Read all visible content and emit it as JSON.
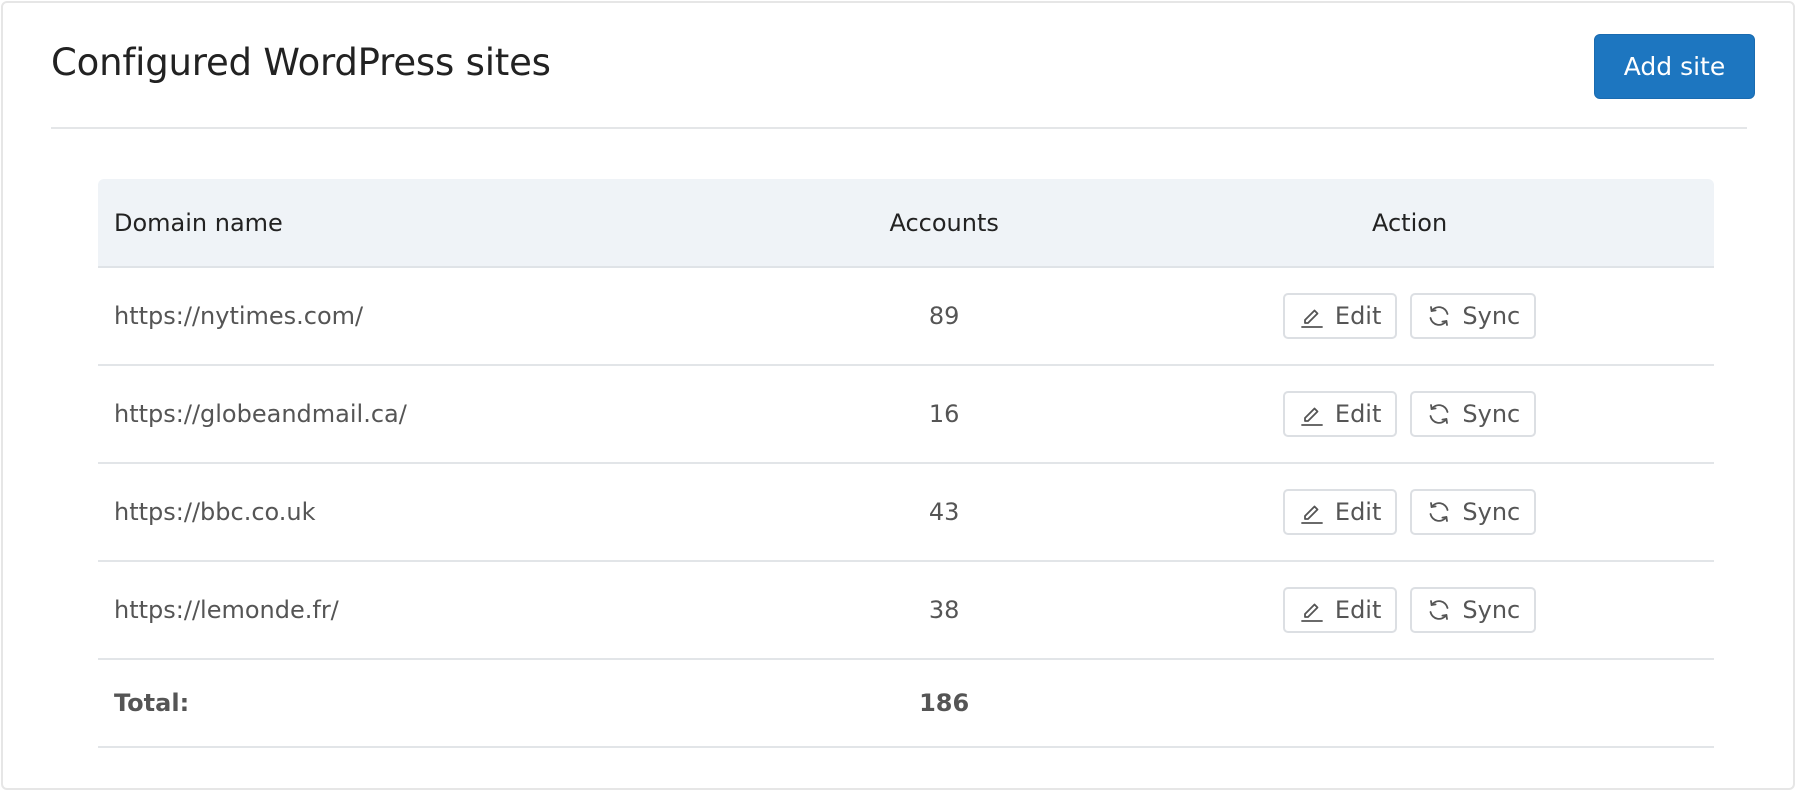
{
  "header": {
    "title": "Configured WordPress sites",
    "add_button_label": "Add site"
  },
  "table": {
    "columns": [
      "Domain name",
      "Accounts",
      "Action"
    ],
    "rows": [
      {
        "domain": "https://nytimes.com/",
        "accounts": "89",
        "edit_label": "Edit",
        "sync_label": "Sync"
      },
      {
        "domain": "https://globeandmail.ca/",
        "accounts": "16",
        "edit_label": "Edit",
        "sync_label": "Sync"
      },
      {
        "domain": "https://bbc.co.uk",
        "accounts": "43",
        "edit_label": "Edit",
        "sync_label": "Sync"
      },
      {
        "domain": "https://lemonde.fr/",
        "accounts": "38",
        "edit_label": "Edit",
        "sync_label": "Sync"
      }
    ],
    "total": {
      "label": "Total:",
      "value": "186"
    }
  },
  "icons": {
    "edit": "pencil-icon",
    "sync": "sync-icon"
  },
  "colors": {
    "accent": "#1d76c0",
    "header_bg": "#eff3f7",
    "border": "#e2e5e8"
  }
}
